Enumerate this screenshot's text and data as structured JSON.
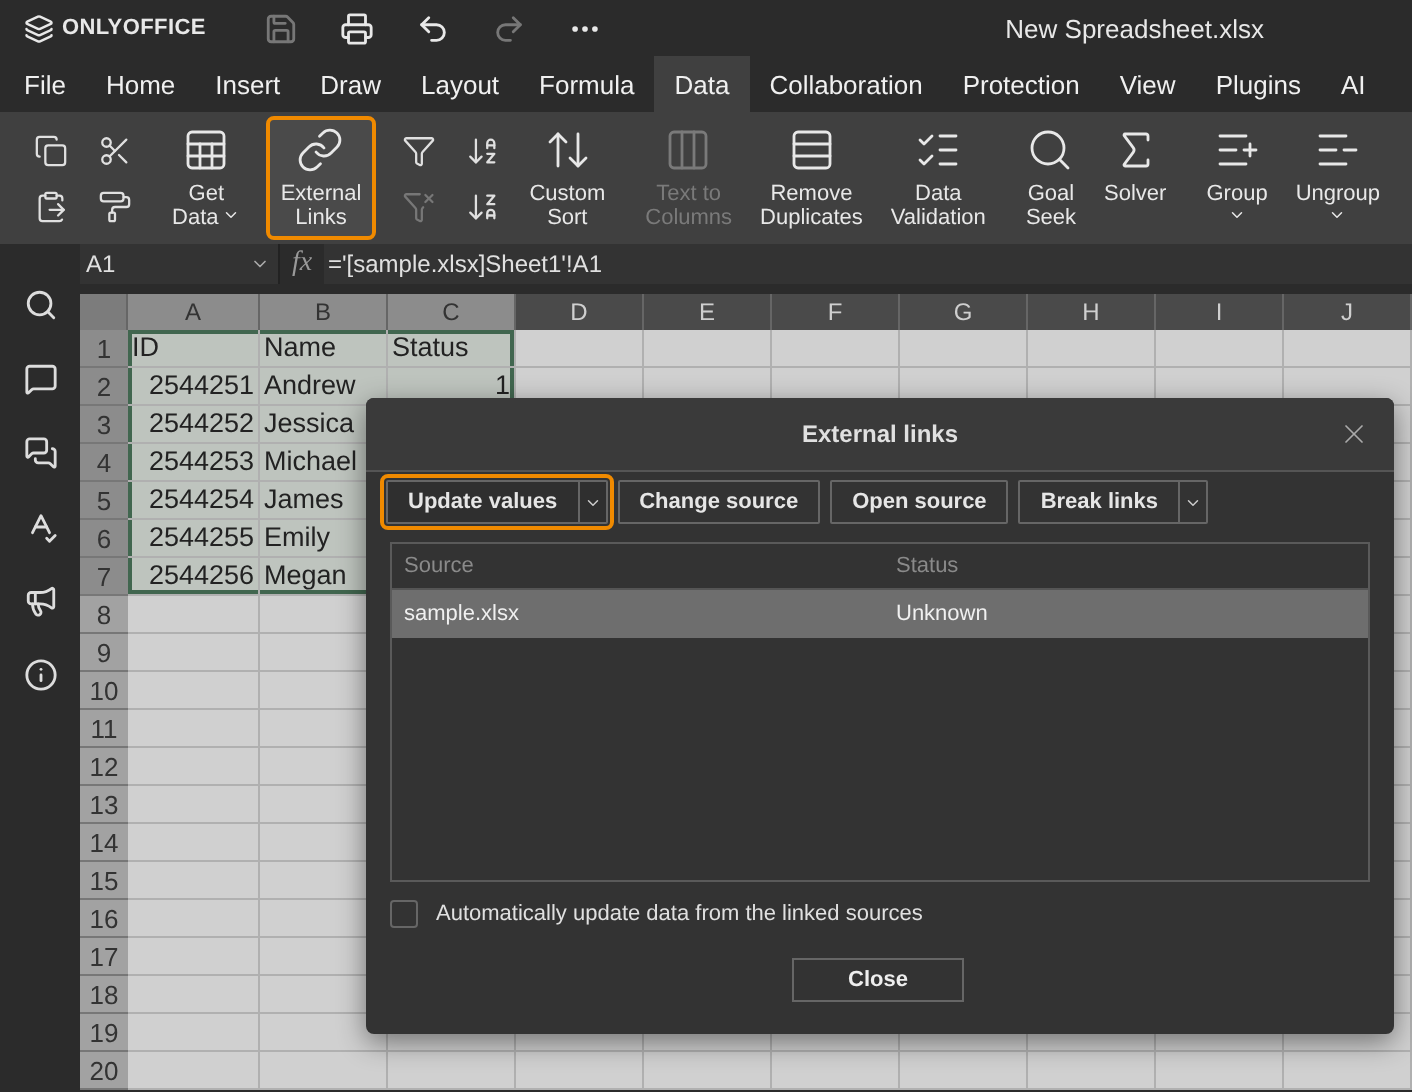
{
  "title_bar": {
    "app_name": "ONLYOFFICE",
    "document_title": "New Spreadsheet.xlsx",
    "quick_tools": [
      {
        "disabled": true
      },
      {
        "disabled": false
      },
      {
        "disabled": false
      },
      {
        "disabled": true
      },
      {
        "disabled": false
      }
    ]
  },
  "menu_tabs": [
    {
      "label": "File",
      "selected": false
    },
    {
      "label": "Home",
      "selected": false
    },
    {
      "label": "Insert",
      "selected": false
    },
    {
      "label": "Draw",
      "selected": false
    },
    {
      "label": "Layout",
      "selected": false
    },
    {
      "label": "Formula",
      "selected": false
    },
    {
      "label": "Data",
      "selected": true
    },
    {
      "label": "Collaboration",
      "selected": false
    },
    {
      "label": "Protection",
      "selected": false
    },
    {
      "label": "View",
      "selected": false
    },
    {
      "label": "Plugins",
      "selected": false
    },
    {
      "label": "AI",
      "selected": false
    }
  ],
  "ribbon": [
    {
      "tools": [
        {
          "disabled": false
        },
        {
          "disabled": false
        },
        {
          "disabled": false
        },
        {
          "disabled": false
        }
      ]
    },
    {
      "buttons": [
        {
          "lines": [
            "Get",
            "Data"
          ],
          "dropdown": true,
          "disabled": false,
          "highlighted": false
        }
      ]
    },
    {
      "buttons": [
        {
          "lines": [
            "External",
            "Links"
          ],
          "dropdown": false,
          "disabled": false,
          "highlighted": true
        }
      ]
    },
    {
      "tools": [
        {
          "disabled": false
        },
        {
          "disabled": true
        },
        {
          "disabled": false
        },
        {
          "disabled": false
        }
      ],
      "buttons": [
        {
          "lines": [
            "Custom",
            "Sort"
          ],
          "dropdown": false,
          "disabled": false,
          "highlighted": false
        }
      ]
    },
    {
      "buttons": [
        {
          "lines": [
            "Text to",
            "Columns"
          ],
          "dropdown": false,
          "disabled": true,
          "highlighted": false
        },
        {
          "lines": [
            "Remove",
            "Duplicates"
          ],
          "dropdown": false,
          "disabled": false,
          "highlighted": false
        },
        {
          "lines": [
            "Data",
            "Validation"
          ],
          "dropdown": false,
          "disabled": false,
          "highlighted": false
        }
      ]
    },
    {
      "buttons": [
        {
          "lines": [
            "Goal",
            "Seek"
          ],
          "dropdown": false,
          "disabled": false,
          "highlighted": false
        },
        {
          "lines": [
            "Solver"
          ],
          "dropdown": false,
          "disabled": false,
          "highlighted": false
        }
      ]
    },
    {
      "buttons": [
        {
          "lines": [
            "Group"
          ],
          "dropdown": true,
          "disabled": false,
          "highlighted": false
        },
        {
          "lines": [
            "Ungroup"
          ],
          "dropdown": true,
          "disabled": false,
          "highlighted": false
        }
      ]
    }
  ],
  "formula_bar": {
    "name_box": "A1",
    "fx": "fx",
    "formula": "='[sample.xlsx]Sheet1'!A1"
  },
  "sheet": {
    "columns": [
      {
        "label": "A",
        "selected": true
      },
      {
        "label": "B",
        "selected": true
      },
      {
        "label": "C",
        "selected": true
      },
      {
        "label": "D",
        "selected": false
      },
      {
        "label": "E",
        "selected": false
      },
      {
        "label": "F",
        "selected": false
      },
      {
        "label": "G",
        "selected": false
      },
      {
        "label": "H",
        "selected": false
      },
      {
        "label": "I",
        "selected": false
      },
      {
        "label": "J",
        "selected": false
      }
    ],
    "rows": [
      {
        "number": "1",
        "selected": true,
        "cells": [
          {
            "text": "ID",
            "kind": "text"
          },
          {
            "text": "Name",
            "kind": "text"
          },
          {
            "text": "Status",
            "kind": "text"
          }
        ]
      },
      {
        "number": "2",
        "selected": true,
        "cells": [
          {
            "text": "2544251",
            "kind": "number"
          },
          {
            "text": "Andrew",
            "kind": "text"
          },
          {
            "text": "1",
            "kind": "number"
          }
        ]
      },
      {
        "number": "3",
        "selected": true,
        "cells": [
          {
            "text": "2544252",
            "kind": "number"
          },
          {
            "text": "Jessica",
            "kind": "text"
          }
        ]
      },
      {
        "number": "4",
        "selected": true,
        "cells": [
          {
            "text": "2544253",
            "kind": "number"
          },
          {
            "text": "Michael",
            "kind": "text"
          }
        ]
      },
      {
        "number": "5",
        "selected": true,
        "cells": [
          {
            "text": "2544254",
            "kind": "number"
          },
          {
            "text": "James",
            "kind": "text"
          }
        ]
      },
      {
        "number": "6",
        "selected": true,
        "cells": [
          {
            "text": "2544255",
            "kind": "number"
          },
          {
            "text": "Emily",
            "kind": "text"
          }
        ]
      },
      {
        "number": "7",
        "selected": true,
        "cells": [
          {
            "text": "2544256",
            "kind": "number"
          },
          {
            "text": "Megan",
            "kind": "text"
          }
        ]
      },
      {
        "number": "8",
        "selected": false,
        "cells": []
      },
      {
        "number": "9",
        "selected": false,
        "cells": []
      },
      {
        "number": "10",
        "selected": false,
        "cells": []
      },
      {
        "number": "11",
        "selected": false,
        "cells": []
      },
      {
        "number": "12",
        "selected": false,
        "cells": []
      },
      {
        "number": "13",
        "selected": false,
        "cells": []
      },
      {
        "number": "14",
        "selected": false,
        "cells": []
      },
      {
        "number": "15",
        "selected": false,
        "cells": []
      },
      {
        "number": "16",
        "selected": false,
        "cells": []
      },
      {
        "number": "17",
        "selected": false,
        "cells": []
      },
      {
        "number": "18",
        "selected": false,
        "cells": []
      },
      {
        "number": "19",
        "selected": false,
        "cells": []
      },
      {
        "number": "20",
        "selected": false,
        "cells": []
      }
    ]
  },
  "dialog": {
    "title": "External links",
    "buttons": [
      {
        "label": "Update values",
        "split": true,
        "highlighted": true
      },
      {
        "label": "Change source",
        "split": false,
        "highlighted": false
      },
      {
        "label": "Open source",
        "split": false,
        "highlighted": false
      },
      {
        "label": "Break links",
        "split": true,
        "highlighted": false
      }
    ],
    "table": {
      "columns": [
        "Source",
        "Status"
      ],
      "rows": [
        {
          "source": "sample.xlsx",
          "status": "Unknown",
          "selected": true
        }
      ]
    },
    "auto_update": {
      "label": "Automatically update data from the linked sources",
      "checked": false
    },
    "close_button": "Close"
  }
}
